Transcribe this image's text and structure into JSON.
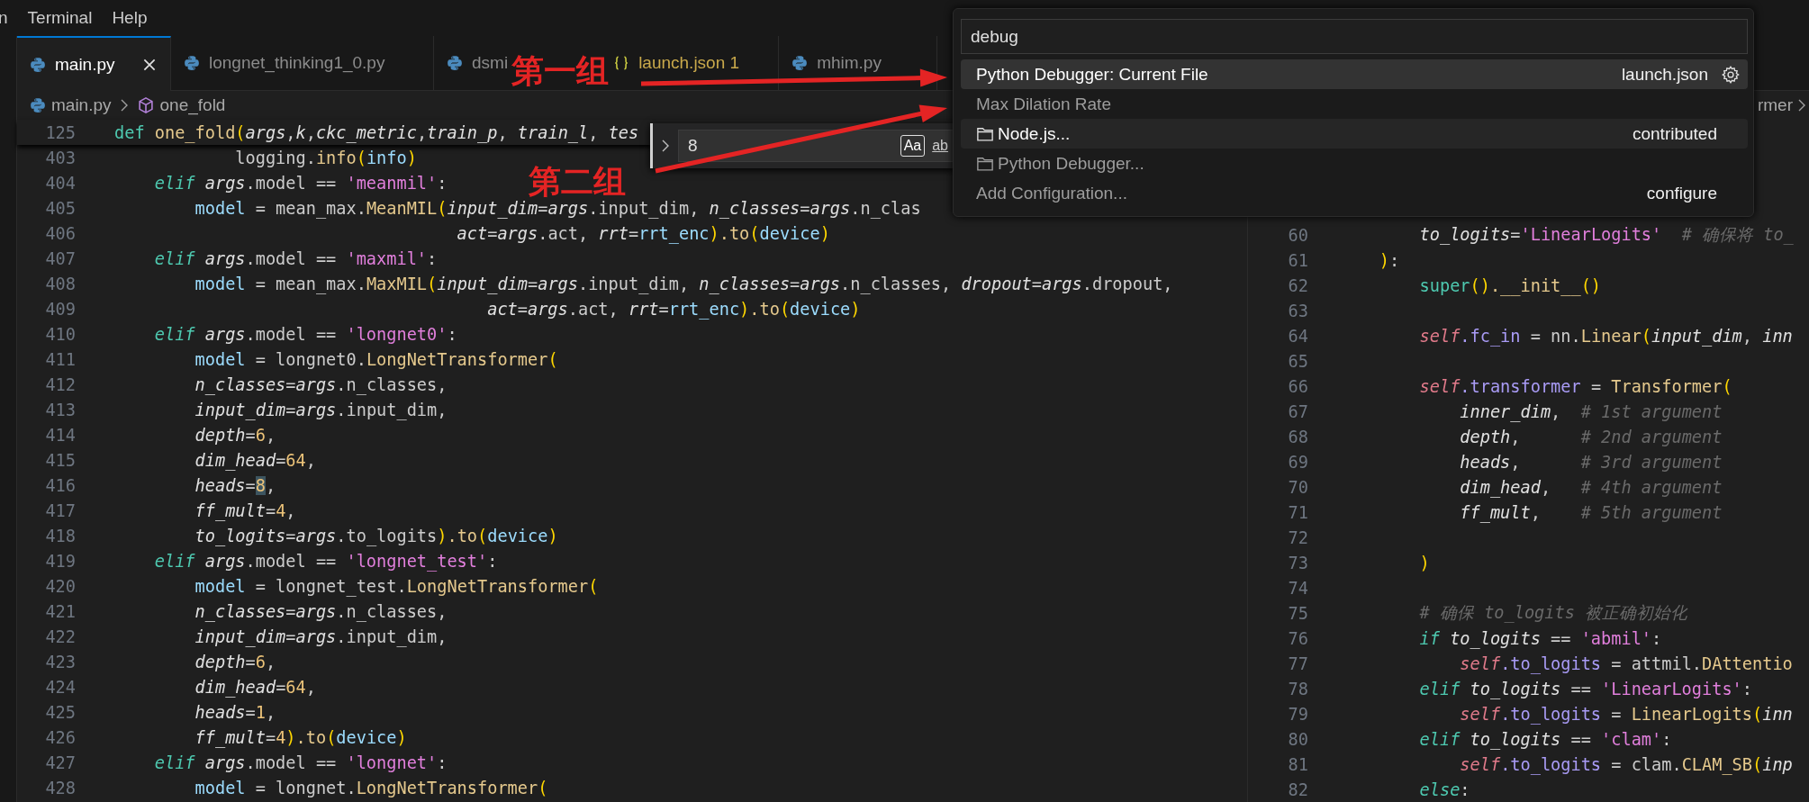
{
  "menu_bar": {
    "items": [
      "n",
      "Terminal",
      "Help"
    ]
  },
  "tabs": [
    {
      "label": "main.py",
      "kind": "python",
      "selected": true,
      "close_button": true
    },
    {
      "label": "longnet_thinking1_0.py",
      "kind": "python",
      "selected": false,
      "close_button": false
    },
    {
      "label": "dsmi",
      "kind": "python",
      "selected": false,
      "close_button": false
    },
    {
      "label": "launch.json 1",
      "kind": "json",
      "selected": false,
      "close_button": false
    },
    {
      "label": "mhim.py",
      "kind": "python",
      "selected": false,
      "close_button": false
    }
  ],
  "breadcrumb": {
    "file": "main.py",
    "symbol": "one_fold"
  },
  "find_widget": {
    "value": "8",
    "options": [
      {
        "label": "Aa",
        "selected": true
      },
      {
        "label": "ab",
        "selected": false
      }
    ]
  },
  "editor_left": {
    "sticky_line": {
      "number": "125",
      "tokens": [
        {
          "kind": "def",
          "text": "def "
        },
        {
          "kind": "function",
          "text": "one_fold"
        },
        {
          "kind": "bracket",
          "text": "("
        },
        {
          "kind": "param",
          "text": "args"
        },
        {
          "kind": "plain",
          "text": ","
        },
        {
          "kind": "param",
          "text": "k"
        },
        {
          "kind": "plain",
          "text": ","
        },
        {
          "kind": "param",
          "text": "ckc_metric"
        },
        {
          "kind": "plain",
          "text": ","
        },
        {
          "kind": "param",
          "text": "train_p"
        },
        {
          "kind": "plain",
          "text": ", "
        },
        {
          "kind": "param",
          "text": "train_l"
        },
        {
          "kind": "plain",
          "text": ", "
        },
        {
          "kind": "param",
          "text": "tes"
        }
      ]
    },
    "lines": [
      {
        "number": "403",
        "tokens": [
          {
            "kind": "plain",
            "text": "            logging."
          },
          {
            "kind": "function",
            "text": "info"
          },
          {
            "kind": "bracket",
            "text": "("
          },
          {
            "kind": "variable",
            "text": "info"
          },
          {
            "kind": "bracket",
            "text": ")"
          }
        ]
      },
      {
        "number": "404",
        "tokens": [
          {
            "kind": "keyword",
            "text": "    elif "
          },
          {
            "kind": "param",
            "text": "args"
          },
          {
            "kind": "plain",
            "text": ".model == "
          },
          {
            "kind": "string",
            "text": "'meanmil'"
          },
          {
            "kind": "plain",
            "text": ":"
          }
        ]
      },
      {
        "number": "405",
        "tokens": [
          {
            "kind": "variable",
            "text": "        model"
          },
          {
            "kind": "plain",
            "text": " = mean_max."
          },
          {
            "kind": "function",
            "text": "MeanMIL"
          },
          {
            "kind": "bracket",
            "text": "("
          },
          {
            "kind": "param",
            "text": "input_dim"
          },
          {
            "kind": "plain",
            "text": "="
          },
          {
            "kind": "param",
            "text": "args"
          },
          {
            "kind": "plain",
            "text": ".input_dim, "
          },
          {
            "kind": "param",
            "text": "n_classes"
          },
          {
            "kind": "plain",
            "text": "="
          },
          {
            "kind": "param",
            "text": "args"
          },
          {
            "kind": "plain",
            "text": ".n_clas"
          }
        ]
      },
      {
        "number": "406",
        "tokens": [
          {
            "kind": "param",
            "text": "                                  act"
          },
          {
            "kind": "plain",
            "text": "="
          },
          {
            "kind": "param",
            "text": "args"
          },
          {
            "kind": "plain",
            "text": ".act, "
          },
          {
            "kind": "param",
            "text": "rrt"
          },
          {
            "kind": "plain",
            "text": "="
          },
          {
            "kind": "variable",
            "text": "rrt_enc"
          },
          {
            "kind": "bracket",
            "text": ")"
          },
          {
            "kind": "function",
            "text": ".to"
          },
          {
            "kind": "bracket",
            "text": "("
          },
          {
            "kind": "variable",
            "text": "device"
          },
          {
            "kind": "bracket",
            "text": ")"
          }
        ]
      },
      {
        "number": "407",
        "tokens": [
          {
            "kind": "keyword",
            "text": "    elif "
          },
          {
            "kind": "param",
            "text": "args"
          },
          {
            "kind": "plain",
            "text": ".model == "
          },
          {
            "kind": "string",
            "text": "'maxmil'"
          },
          {
            "kind": "plain",
            "text": ":"
          }
        ]
      },
      {
        "number": "408",
        "tokens": [
          {
            "kind": "variable",
            "text": "        model"
          },
          {
            "kind": "plain",
            "text": " = mean_max."
          },
          {
            "kind": "function",
            "text": "MaxMIL"
          },
          {
            "kind": "bracket",
            "text": "("
          },
          {
            "kind": "param",
            "text": "input_dim"
          },
          {
            "kind": "plain",
            "text": "="
          },
          {
            "kind": "param",
            "text": "args"
          },
          {
            "kind": "plain",
            "text": ".input_dim, "
          },
          {
            "kind": "param",
            "text": "n_classes"
          },
          {
            "kind": "plain",
            "text": "="
          },
          {
            "kind": "param",
            "text": "args"
          },
          {
            "kind": "plain",
            "text": ".n_classes, "
          },
          {
            "kind": "param",
            "text": "dropout"
          },
          {
            "kind": "plain",
            "text": "="
          },
          {
            "kind": "param",
            "text": "args"
          },
          {
            "kind": "plain",
            "text": ".dropout,"
          }
        ]
      },
      {
        "number": "409",
        "tokens": [
          {
            "kind": "param",
            "text": "                                     act"
          },
          {
            "kind": "plain",
            "text": "="
          },
          {
            "kind": "param",
            "text": "args"
          },
          {
            "kind": "plain",
            "text": ".act, "
          },
          {
            "kind": "param",
            "text": "rrt"
          },
          {
            "kind": "plain",
            "text": "="
          },
          {
            "kind": "variable",
            "text": "rrt_enc"
          },
          {
            "kind": "bracket",
            "text": ")"
          },
          {
            "kind": "function",
            "text": ".to"
          },
          {
            "kind": "bracket",
            "text": "("
          },
          {
            "kind": "variable",
            "text": "device"
          },
          {
            "kind": "bracket",
            "text": ")"
          }
        ]
      },
      {
        "number": "410",
        "tokens": [
          {
            "kind": "keyword",
            "text": "    elif "
          },
          {
            "kind": "param",
            "text": "args"
          },
          {
            "kind": "plain",
            "text": ".model == "
          },
          {
            "kind": "string",
            "text": "'longnet0'"
          },
          {
            "kind": "plain",
            "text": ":"
          }
        ]
      },
      {
        "number": "411",
        "tokens": [
          {
            "kind": "variable",
            "text": "        model"
          },
          {
            "kind": "plain",
            "text": " = longnet0."
          },
          {
            "kind": "function",
            "text": "LongNetTransformer"
          },
          {
            "kind": "bracket",
            "text": "("
          }
        ]
      },
      {
        "number": "412",
        "tokens": [
          {
            "kind": "param",
            "text": "        n_classes"
          },
          {
            "kind": "plain",
            "text": "="
          },
          {
            "kind": "param",
            "text": "args"
          },
          {
            "kind": "plain",
            "text": ".n_classes,"
          }
        ]
      },
      {
        "number": "413",
        "tokens": [
          {
            "kind": "param",
            "text": "        input_dim"
          },
          {
            "kind": "plain",
            "text": "="
          },
          {
            "kind": "param",
            "text": "args"
          },
          {
            "kind": "plain",
            "text": ".input_dim,"
          }
        ]
      },
      {
        "number": "414",
        "tokens": [
          {
            "kind": "param",
            "text": "        depth"
          },
          {
            "kind": "plain",
            "text": "="
          },
          {
            "kind": "number",
            "text": "6"
          },
          {
            "kind": "plain",
            "text": ","
          }
        ]
      },
      {
        "number": "415",
        "tokens": [
          {
            "kind": "param",
            "text": "        dim_head"
          },
          {
            "kind": "plain",
            "text": "="
          },
          {
            "kind": "number",
            "text": "64"
          },
          {
            "kind": "plain",
            "text": ","
          }
        ]
      },
      {
        "number": "416",
        "tokens": [
          {
            "kind": "param",
            "text": "        heads"
          },
          {
            "kind": "plain",
            "text": "="
          },
          {
            "kind": "match",
            "text": "8"
          },
          {
            "kind": "plain",
            "text": ","
          }
        ]
      },
      {
        "number": "417",
        "tokens": [
          {
            "kind": "param",
            "text": "        ff_mult"
          },
          {
            "kind": "plain",
            "text": "="
          },
          {
            "kind": "number",
            "text": "4"
          },
          {
            "kind": "plain",
            "text": ","
          }
        ]
      },
      {
        "number": "418",
        "tokens": [
          {
            "kind": "param",
            "text": "        to_logits"
          },
          {
            "kind": "plain",
            "text": "="
          },
          {
            "kind": "param",
            "text": "args"
          },
          {
            "kind": "plain",
            "text": ".to_logits"
          },
          {
            "kind": "bracket",
            "text": ")"
          },
          {
            "kind": "function",
            "text": ".to"
          },
          {
            "kind": "bracket",
            "text": "("
          },
          {
            "kind": "variable",
            "text": "device"
          },
          {
            "kind": "bracket",
            "text": ")"
          }
        ]
      },
      {
        "number": "419",
        "tokens": [
          {
            "kind": "keyword",
            "text": "    elif "
          },
          {
            "kind": "param",
            "text": "args"
          },
          {
            "kind": "plain",
            "text": ".model == "
          },
          {
            "kind": "string",
            "text": "'longnet_test'"
          },
          {
            "kind": "plain",
            "text": ":"
          }
        ]
      },
      {
        "number": "420",
        "tokens": [
          {
            "kind": "variable",
            "text": "        model"
          },
          {
            "kind": "plain",
            "text": " = longnet_test."
          },
          {
            "kind": "function",
            "text": "LongNetTransformer"
          },
          {
            "kind": "bracket",
            "text": "("
          }
        ]
      },
      {
        "number": "421",
        "tokens": [
          {
            "kind": "param",
            "text": "        n_classes"
          },
          {
            "kind": "plain",
            "text": "="
          },
          {
            "kind": "param",
            "text": "args"
          },
          {
            "kind": "plain",
            "text": ".n_classes,"
          }
        ]
      },
      {
        "number": "422",
        "tokens": [
          {
            "kind": "param",
            "text": "        input_dim"
          },
          {
            "kind": "plain",
            "text": "="
          },
          {
            "kind": "param",
            "text": "args"
          },
          {
            "kind": "plain",
            "text": ".input_dim,"
          }
        ]
      },
      {
        "number": "423",
        "tokens": [
          {
            "kind": "param",
            "text": "        depth"
          },
          {
            "kind": "plain",
            "text": "="
          },
          {
            "kind": "number",
            "text": "6"
          },
          {
            "kind": "plain",
            "text": ","
          }
        ]
      },
      {
        "number": "424",
        "tokens": [
          {
            "kind": "param",
            "text": "        dim_head"
          },
          {
            "kind": "plain",
            "text": "="
          },
          {
            "kind": "number",
            "text": "64"
          },
          {
            "kind": "plain",
            "text": ","
          }
        ]
      },
      {
        "number": "425",
        "tokens": [
          {
            "kind": "param",
            "text": "        heads"
          },
          {
            "kind": "plain",
            "text": "="
          },
          {
            "kind": "number",
            "text": "1"
          },
          {
            "kind": "plain",
            "text": ","
          }
        ]
      },
      {
        "number": "426",
        "tokens": [
          {
            "kind": "param",
            "text": "        ff_mult"
          },
          {
            "kind": "plain",
            "text": "="
          },
          {
            "kind": "number",
            "text": "4"
          },
          {
            "kind": "bracket",
            "text": ")"
          },
          {
            "kind": "function",
            "text": ".to"
          },
          {
            "kind": "bracket",
            "text": "("
          },
          {
            "kind": "variable",
            "text": "device"
          },
          {
            "kind": "bracket",
            "text": ")"
          }
        ]
      },
      {
        "number": "427",
        "tokens": [
          {
            "kind": "keyword",
            "text": "    elif "
          },
          {
            "kind": "param",
            "text": "args"
          },
          {
            "kind": "plain",
            "text": ".model == "
          },
          {
            "kind": "string",
            "text": "'longnet'"
          },
          {
            "kind": "plain",
            "text": ":"
          }
        ]
      },
      {
        "number": "428",
        "tokens": [
          {
            "kind": "variable",
            "text": "        model"
          },
          {
            "kind": "plain",
            "text": " = longnet."
          },
          {
            "kind": "function",
            "text": "LongNetTransformer"
          },
          {
            "kind": "bracket",
            "text": "("
          }
        ]
      }
    ]
  },
  "editor_right": {
    "breadcrumb_tail": "rmer",
    "lines": [
      {
        "number": "60",
        "tokens": [
          {
            "kind": "param",
            "text": "        to_logits"
          },
          {
            "kind": "plain",
            "text": "="
          },
          {
            "kind": "string",
            "text": "'LinearLogits'"
          },
          {
            "kind": "comment",
            "text": "  # 确保将 to_"
          }
        ]
      },
      {
        "number": "61",
        "tokens": [
          {
            "kind": "bracket",
            "text": "    )"
          },
          {
            "kind": "plain",
            "text": ":"
          }
        ]
      },
      {
        "number": "62",
        "tokens": [
          {
            "kind": "builtin",
            "text": "        super"
          },
          {
            "kind": "bracket",
            "text": "()"
          },
          {
            "kind": "function",
            "text": ".__init__"
          },
          {
            "kind": "bracket",
            "text": "()"
          }
        ]
      },
      {
        "number": "63"
      },
      {
        "number": "64",
        "tokens": [
          {
            "kind": "self",
            "text": "        self"
          },
          {
            "kind": "attribute",
            "text": ".fc_in"
          },
          {
            "kind": "plain",
            "text": " = nn."
          },
          {
            "kind": "function",
            "text": "Linear"
          },
          {
            "kind": "bracket",
            "text": "("
          },
          {
            "kind": "param",
            "text": "input_dim"
          },
          {
            "kind": "plain",
            "text": ", "
          },
          {
            "kind": "param",
            "text": "inn"
          }
        ]
      },
      {
        "number": "65"
      },
      {
        "number": "66",
        "tokens": [
          {
            "kind": "self",
            "text": "        self"
          },
          {
            "kind": "attribute",
            "text": ".transformer"
          },
          {
            "kind": "plain",
            "text": " = "
          },
          {
            "kind": "function",
            "text": "Transformer"
          },
          {
            "kind": "bracket",
            "text": "("
          }
        ]
      },
      {
        "number": "67",
        "tokens": [
          {
            "kind": "param",
            "text": "            inner_dim"
          },
          {
            "kind": "plain",
            "text": ",  "
          },
          {
            "kind": "comment",
            "text": "# 1st argument"
          }
        ]
      },
      {
        "number": "68",
        "tokens": [
          {
            "kind": "param",
            "text": "            depth"
          },
          {
            "kind": "plain",
            "text": ",      "
          },
          {
            "kind": "comment",
            "text": "# 2nd argument"
          }
        ]
      },
      {
        "number": "69",
        "tokens": [
          {
            "kind": "param",
            "text": "            heads"
          },
          {
            "kind": "plain",
            "text": ",      "
          },
          {
            "kind": "comment",
            "text": "# 3rd argument"
          }
        ]
      },
      {
        "number": "70",
        "tokens": [
          {
            "kind": "param",
            "text": "            dim_head"
          },
          {
            "kind": "plain",
            "text": ",   "
          },
          {
            "kind": "comment",
            "text": "# 4th argument"
          }
        ]
      },
      {
        "number": "71",
        "tokens": [
          {
            "kind": "param",
            "text": "            ff_mult"
          },
          {
            "kind": "plain",
            "text": ",    "
          },
          {
            "kind": "comment",
            "text": "# 5th argument"
          }
        ]
      },
      {
        "number": "72"
      },
      {
        "number": "73",
        "tokens": [
          {
            "kind": "bracket",
            "text": "        )"
          }
        ]
      },
      {
        "number": "74"
      },
      {
        "number": "75",
        "tokens": [
          {
            "kind": "comment",
            "text": "        # 确保 to_logits 被正确初始化"
          }
        ]
      },
      {
        "number": "76",
        "tokens": [
          {
            "kind": "keyword",
            "text": "        if "
          },
          {
            "kind": "param",
            "text": "to_logits"
          },
          {
            "kind": "plain",
            "text": " == "
          },
          {
            "kind": "string",
            "text": "'abmil'"
          },
          {
            "kind": "plain",
            "text": ":"
          }
        ]
      },
      {
        "number": "77",
        "tokens": [
          {
            "kind": "self",
            "text": "            self"
          },
          {
            "kind": "attribute",
            "text": ".to_logits"
          },
          {
            "kind": "plain",
            "text": " = attmil."
          },
          {
            "kind": "function",
            "text": "DAttentio"
          }
        ]
      },
      {
        "number": "78",
        "tokens": [
          {
            "kind": "keyword",
            "text": "        elif "
          },
          {
            "kind": "param",
            "text": "to_logits"
          },
          {
            "kind": "plain",
            "text": " == "
          },
          {
            "kind": "string",
            "text": "'LinearLogits'"
          },
          {
            "kind": "plain",
            "text": ":"
          }
        ]
      },
      {
        "number": "79",
        "tokens": [
          {
            "kind": "self",
            "text": "            self"
          },
          {
            "kind": "attribute",
            "text": ".to_logits"
          },
          {
            "kind": "plain",
            "text": " = "
          },
          {
            "kind": "function",
            "text": "LinearLogits"
          },
          {
            "kind": "bracket",
            "text": "("
          },
          {
            "kind": "param",
            "text": "inn"
          }
        ]
      },
      {
        "number": "80",
        "tokens": [
          {
            "kind": "keyword",
            "text": "        elif "
          },
          {
            "kind": "param",
            "text": "to_logits"
          },
          {
            "kind": "plain",
            "text": " == "
          },
          {
            "kind": "string",
            "text": "'clam'"
          },
          {
            "kind": "plain",
            "text": ":"
          }
        ]
      },
      {
        "number": "81",
        "tokens": [
          {
            "kind": "self",
            "text": "            self"
          },
          {
            "kind": "attribute",
            "text": ".to_logits"
          },
          {
            "kind": "plain",
            "text": " = clam."
          },
          {
            "kind": "function",
            "text": "CLAM_SB"
          },
          {
            "kind": "bracket",
            "text": "("
          },
          {
            "kind": "param",
            "text": "inp"
          }
        ]
      },
      {
        "number": "82",
        "tokens": [
          {
            "kind": "keyword",
            "text": "        else"
          },
          {
            "kind": "plain",
            "text": ":"
          }
        ]
      }
    ]
  },
  "quick_pick": {
    "query": "debug",
    "items": [
      {
        "label": "Python Debugger: Current File",
        "kind": "configuration",
        "detail": "launch.json",
        "settings_button": true,
        "selected": true,
        "hovered": false
      },
      {
        "label": "Max Dilation Rate",
        "kind": "configuration",
        "settings_button": false,
        "selected": false,
        "hovered": false
      },
      {
        "label": "Node.js...",
        "kind": "provider",
        "detail": "contributed",
        "settings_button": false,
        "selected": false,
        "hovered": true
      },
      {
        "label": "Python Debugger...",
        "kind": "provider",
        "settings_button": false,
        "selected": false,
        "hovered": false
      },
      {
        "label": "Add Configuration...",
        "kind": "action",
        "detail": "configure",
        "settings_button": false,
        "selected": false,
        "hovered": false
      }
    ]
  },
  "annotations": [
    {
      "text": "第一组"
    },
    {
      "text": "第二组"
    }
  ]
}
